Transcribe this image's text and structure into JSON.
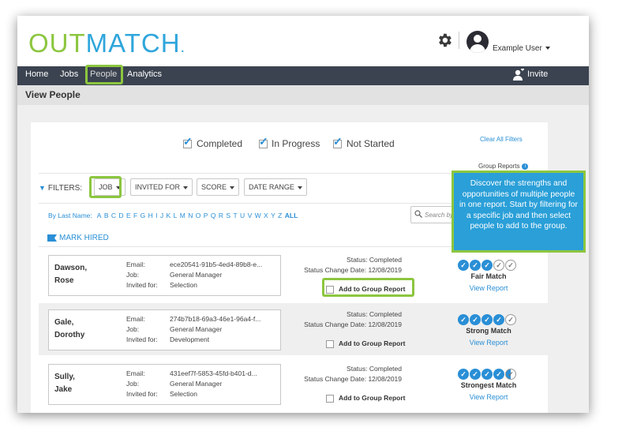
{
  "header": {
    "logo_part1": "OUT",
    "logo_part2": "MATCH",
    "logo_dot": ".",
    "username": "Example User"
  },
  "nav": {
    "items": [
      "Home",
      "Jobs",
      "People",
      "Analytics"
    ],
    "active": "People",
    "invite_label": "Invite"
  },
  "page": {
    "title": "View People"
  },
  "status_filters": [
    {
      "label": "Completed",
      "checked": true
    },
    {
      "label": "In Progress",
      "checked": true
    },
    {
      "label": "Not Started",
      "checked": true
    }
  ],
  "clear_filters": "Clear All Filters",
  "group_reports": "Group Reports",
  "filters": {
    "label": "FILTERS:",
    "dropdowns": [
      "JOB",
      "INVITED FOR",
      "SCORE",
      "DATE RANGE"
    ]
  },
  "alphabet": {
    "label": "By Last Name:",
    "letters": [
      "A",
      "B",
      "C",
      "D",
      "E",
      "F",
      "G",
      "H",
      "I",
      "J",
      "K",
      "L",
      "M",
      "N",
      "O",
      "P",
      "Q",
      "R",
      "S",
      "T",
      "U",
      "V",
      "W",
      "X",
      "Y",
      "Z"
    ],
    "all": "ALL"
  },
  "search": {
    "placeholder": "Search by Las"
  },
  "mark_hired": "MARK HIRED",
  "labels": {
    "email": "Email:",
    "job": "Job:",
    "invited_for": "Invited for:",
    "status": "Status:",
    "status_change": "Status Change Date:",
    "add_to_group": "Add to Group Report",
    "view_report": "View Report"
  },
  "people": [
    {
      "first": "Dawson,",
      "last": "Rose",
      "email": "ece20541-91b5-4ed4-89b8-e...",
      "job": "General Manager",
      "invited_for": "Selection",
      "status": "Completed",
      "status_date": "12/08/2019",
      "score": 3,
      "match": "Fair Match"
    },
    {
      "first": "Gale,",
      "last": "Dorothy",
      "email": "274b7b18-69a3-46e1-96a4-f...",
      "job": "General Manager",
      "invited_for": "Development",
      "status": "Completed",
      "status_date": "12/08/2019",
      "score": 4,
      "match": "Strong Match"
    },
    {
      "first": "Sully,",
      "last": "Jake",
      "email": "431eef7f-5853-45fd-b401-d...",
      "job": "General Manager",
      "invited_for": "Selection",
      "status": "Completed",
      "status_date": "12/08/2019",
      "score": 4.5,
      "match": "Strongest Match"
    }
  ],
  "tooltip": {
    "text": "Discover the strengths and opportunities of multiple people in one report. Start by filtering for a specific job and then select people to add to the group."
  },
  "colors": {
    "brand_green": "#8cc63f",
    "brand_blue": "#2fa6dc",
    "nav_bg": "#3b4350",
    "link_blue": "#2a8fd6"
  }
}
